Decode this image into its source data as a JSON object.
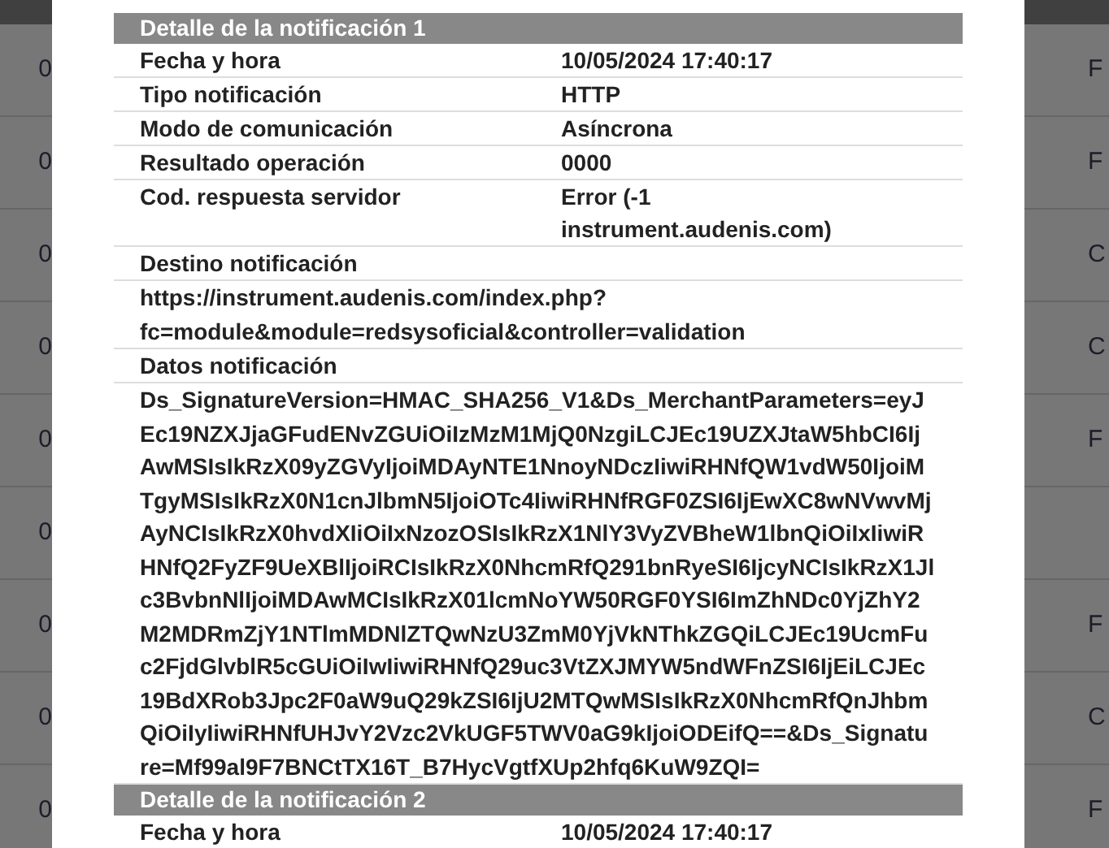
{
  "background_table": {
    "rows": [
      {
        "column_1": "0",
        "column_2": "F"
      },
      {
        "column_1": "0",
        "column_2": "F"
      },
      {
        "column_1": "0",
        "column_2": "C"
      },
      {
        "column_1": "0",
        "column_2": "C"
      },
      {
        "column_1": "0",
        "column_2": "F"
      },
      {
        "column_1": "0"
      },
      {
        "column_1": "0",
        "column_2": "F"
      },
      {
        "column_1": "0",
        "column_2": "C"
      },
      {
        "column_1": "0",
        "column_2": "F"
      }
    ]
  },
  "notifications": [
    {
      "title": "Detalle de la notificación 1",
      "rows": [
        {
          "kind": "pair",
          "label": "Fecha y hora",
          "value": "10/05/2024 17:40:17"
        },
        {
          "kind": "pair",
          "label": "Tipo notificación",
          "value": "HTTP"
        },
        {
          "kind": "pair",
          "label": "Modo de comunicación",
          "value": "Asíncrona"
        },
        {
          "kind": "pair",
          "label": "Resultado operación",
          "value": "0000"
        },
        {
          "kind": "pair",
          "label": "Cod. respuesta servidor",
          "value": "Error (-1 instrument.audenis.com)"
        },
        {
          "kind": "heading",
          "label": "Destino notificación"
        },
        {
          "kind": "text",
          "value": "https://instrument.audenis.com/index.php?fc=module&module=redsysoficial&controller=validation"
        },
        {
          "kind": "heading",
          "label": "Datos notificación"
        },
        {
          "kind": "text",
          "value": "Ds_SignatureVersion=HMAC_SHA256_V1&Ds_MerchantParameters=eyJEc19NZXJjaGFudENvZGUiOiIzMzM1MjQ0NzgiLCJEc19UZXJtaW5hbCI6IjAwMSIsIkRzX09yZGVyIjoiMDAyNTE1NnoyNDczIiwiRHNfQW1vdW50IjoiMTgyMSIsIkRzX0N1cnJlbmN5IjoiOTc4IiwiRHNfRGF0ZSI6IjEwXC8wNVwvMjAyNCIsIkRzX0hvdXIiOiIxNzozOSIsIkRzX1NlY3VyZVBheW1lbnQiOiIxIiwiRHNfQ2FyZF9UeXBlIjoiRCIsIkRzX0NhcmRfQ291bnRyeSI6IjcyNCIsIkRzX1Jlc3BvbnNlIjoiMDAwMCIsIkRzX01lcmNoYW50RGF0YSI6ImZhNDc0YjZhY2M2MDRmZjY1NTlmMDNlZTQwNzU3ZmM0YjVkNThkZGQiLCJEc19UcmFuc2FjdGlvblR5cGUiOiIwIiwiRHNfQ29uc3VtZXJMYW5ndWFnZSI6IjEiLCJEc19BdXRob3Jpc2F0aW9uQ29kZSI6IjU2MTQwMSIsIkRzX0NhcmRfQnJhbmQiOiIyIiwiRHNfUHJvY2Vzc2VkUGF5TWV0aG9kIjoiODEifQ==&Ds_Signature=Mf99al9F7BNCtTX16T_B7HycVgtfXUp2hfq6KuW9ZQI="
        }
      ]
    },
    {
      "title": "Detalle de la notificación 2",
      "rows": [
        {
          "kind": "pair",
          "label": "Fecha y hora",
          "value": "10/05/2024 17:40:17"
        }
      ]
    }
  ]
}
